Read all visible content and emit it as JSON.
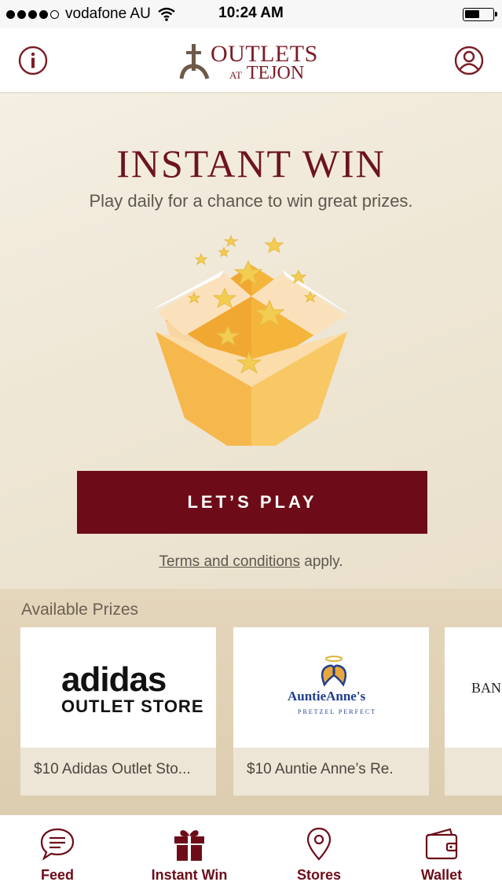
{
  "status_bar": {
    "carrier": "vodafone AU",
    "time": "10:24 AM",
    "signal_bars": 4,
    "battery_level": 0.55,
    "wifi_icon": "wifi-icon",
    "battery_icon": "battery-icon"
  },
  "header": {
    "logo_line1": "OUTLETS",
    "logo_at": "AT",
    "logo_line2": "TEJON",
    "info_icon": "info-icon",
    "profile_icon": "user-profile-icon",
    "accent_color": "#7b1c25"
  },
  "hero": {
    "title": "INSTANT WIN",
    "subtitle": "Play daily for a chance to win great prizes.",
    "illustration": "gift-box-with-stars-icon",
    "play_label": "LET’S PLAY",
    "terms_link": "Terms and conditions",
    "terms_suffix": " apply."
  },
  "prizes": {
    "section_label": "Available Prizes",
    "items": [
      {
        "brand_line1": "adidas",
        "brand_line2": "OUTLET STORE",
        "name": "$10 Adidas Outlet Sto..."
      },
      {
        "brand_line1": "AuntieAnne's",
        "brand_line2": "PRETZEL PERFECT",
        "name": "$10 Auntie Anne’s Re."
      },
      {
        "brand_line1": "BAN",
        "brand_line2": "",
        "name": ""
      }
    ]
  },
  "tabbar": {
    "tabs": [
      {
        "label": "Feed",
        "icon": "chat-bubble-icon"
      },
      {
        "label": "Instant Win",
        "icon": "gift-icon"
      },
      {
        "label": "Stores",
        "icon": "map-pin-icon"
      },
      {
        "label": "Wallet",
        "icon": "wallet-icon"
      }
    ],
    "active_color": "#6d0c18"
  }
}
